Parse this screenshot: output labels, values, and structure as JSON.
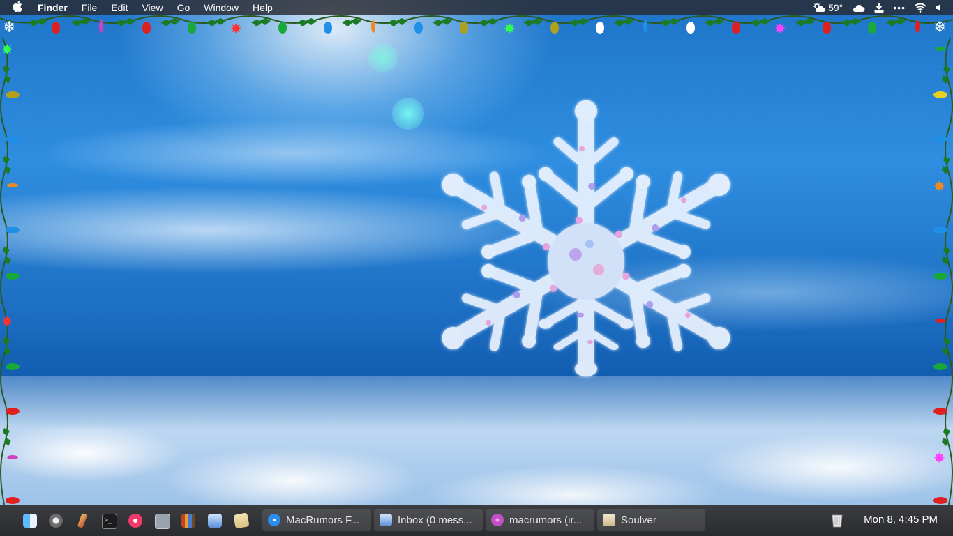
{
  "menubar": {
    "apple_icon": "apple-icon",
    "items": [
      "Finder",
      "File",
      "Edit",
      "View",
      "Go",
      "Window",
      "Help"
    ],
    "weather_temp": "59°",
    "status_icons": [
      "weather-icon",
      "cloud-icon",
      "download-icon",
      "more-icon",
      "wifi-icon",
      "volume-icon"
    ]
  },
  "taskbar": {
    "launchers": [
      "finder-icon",
      "launchpad-icon",
      "pencil-icon",
      "terminal-icon",
      "itunes-icon",
      "preview-icon",
      "books-icon",
      "app-store-icon",
      "notes-icon"
    ],
    "tasks": [
      {
        "label": "MacRumors F...",
        "icon": "safari-icon",
        "accent": "#2a8df0"
      },
      {
        "label": "Inbox (0 mess...",
        "icon": "mail-icon",
        "accent": "#5a8fd8"
      },
      {
        "label": "macrumors (ir...",
        "icon": "chat-icon",
        "accent": "#c050c8"
      },
      {
        "label": "Soulver",
        "icon": "soulver-icon",
        "accent": "#e8d8a8"
      }
    ],
    "clock": "Mon 8, 4:45 PM"
  },
  "colors": {
    "menubar_bg": "#2a2a30",
    "taskbar_bg": "#2e2f33",
    "light_red": "#e02020",
    "light_green": "#19a83a",
    "light_blue": "#1f8fe8",
    "light_yellow": "#e8d020",
    "holly_green": "#1c7a24"
  }
}
